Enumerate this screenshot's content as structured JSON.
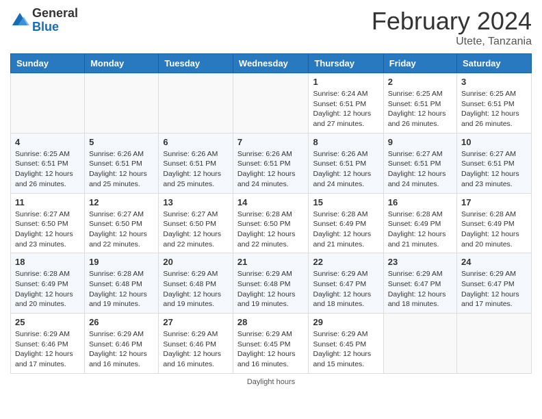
{
  "header": {
    "logo_general": "General",
    "logo_blue": "Blue",
    "month_title": "February 2024",
    "subtitle": "Utete, Tanzania"
  },
  "days_of_week": [
    "Sunday",
    "Monday",
    "Tuesday",
    "Wednesday",
    "Thursday",
    "Friday",
    "Saturday"
  ],
  "weeks": [
    [
      {
        "day": "",
        "info": ""
      },
      {
        "day": "",
        "info": ""
      },
      {
        "day": "",
        "info": ""
      },
      {
        "day": "",
        "info": ""
      },
      {
        "day": "1",
        "info": "Sunrise: 6:24 AM\nSunset: 6:51 PM\nDaylight: 12 hours and 27 minutes."
      },
      {
        "day": "2",
        "info": "Sunrise: 6:25 AM\nSunset: 6:51 PM\nDaylight: 12 hours and 26 minutes."
      },
      {
        "day": "3",
        "info": "Sunrise: 6:25 AM\nSunset: 6:51 PM\nDaylight: 12 hours and 26 minutes."
      }
    ],
    [
      {
        "day": "4",
        "info": "Sunrise: 6:25 AM\nSunset: 6:51 PM\nDaylight: 12 hours and 26 minutes."
      },
      {
        "day": "5",
        "info": "Sunrise: 6:26 AM\nSunset: 6:51 PM\nDaylight: 12 hours and 25 minutes."
      },
      {
        "day": "6",
        "info": "Sunrise: 6:26 AM\nSunset: 6:51 PM\nDaylight: 12 hours and 25 minutes."
      },
      {
        "day": "7",
        "info": "Sunrise: 6:26 AM\nSunset: 6:51 PM\nDaylight: 12 hours and 24 minutes."
      },
      {
        "day": "8",
        "info": "Sunrise: 6:26 AM\nSunset: 6:51 PM\nDaylight: 12 hours and 24 minutes."
      },
      {
        "day": "9",
        "info": "Sunrise: 6:27 AM\nSunset: 6:51 PM\nDaylight: 12 hours and 24 minutes."
      },
      {
        "day": "10",
        "info": "Sunrise: 6:27 AM\nSunset: 6:51 PM\nDaylight: 12 hours and 23 minutes."
      }
    ],
    [
      {
        "day": "11",
        "info": "Sunrise: 6:27 AM\nSunset: 6:50 PM\nDaylight: 12 hours and 23 minutes."
      },
      {
        "day": "12",
        "info": "Sunrise: 6:27 AM\nSunset: 6:50 PM\nDaylight: 12 hours and 22 minutes."
      },
      {
        "day": "13",
        "info": "Sunrise: 6:27 AM\nSunset: 6:50 PM\nDaylight: 12 hours and 22 minutes."
      },
      {
        "day": "14",
        "info": "Sunrise: 6:28 AM\nSunset: 6:50 PM\nDaylight: 12 hours and 22 minutes."
      },
      {
        "day": "15",
        "info": "Sunrise: 6:28 AM\nSunset: 6:49 PM\nDaylight: 12 hours and 21 minutes."
      },
      {
        "day": "16",
        "info": "Sunrise: 6:28 AM\nSunset: 6:49 PM\nDaylight: 12 hours and 21 minutes."
      },
      {
        "day": "17",
        "info": "Sunrise: 6:28 AM\nSunset: 6:49 PM\nDaylight: 12 hours and 20 minutes."
      }
    ],
    [
      {
        "day": "18",
        "info": "Sunrise: 6:28 AM\nSunset: 6:49 PM\nDaylight: 12 hours and 20 minutes."
      },
      {
        "day": "19",
        "info": "Sunrise: 6:28 AM\nSunset: 6:48 PM\nDaylight: 12 hours and 19 minutes."
      },
      {
        "day": "20",
        "info": "Sunrise: 6:29 AM\nSunset: 6:48 PM\nDaylight: 12 hours and 19 minutes."
      },
      {
        "day": "21",
        "info": "Sunrise: 6:29 AM\nSunset: 6:48 PM\nDaylight: 12 hours and 19 minutes."
      },
      {
        "day": "22",
        "info": "Sunrise: 6:29 AM\nSunset: 6:47 PM\nDaylight: 12 hours and 18 minutes."
      },
      {
        "day": "23",
        "info": "Sunrise: 6:29 AM\nSunset: 6:47 PM\nDaylight: 12 hours and 18 minutes."
      },
      {
        "day": "24",
        "info": "Sunrise: 6:29 AM\nSunset: 6:47 PM\nDaylight: 12 hours and 17 minutes."
      }
    ],
    [
      {
        "day": "25",
        "info": "Sunrise: 6:29 AM\nSunset: 6:46 PM\nDaylight: 12 hours and 17 minutes."
      },
      {
        "day": "26",
        "info": "Sunrise: 6:29 AM\nSunset: 6:46 PM\nDaylight: 12 hours and 16 minutes."
      },
      {
        "day": "27",
        "info": "Sunrise: 6:29 AM\nSunset: 6:46 PM\nDaylight: 12 hours and 16 minutes."
      },
      {
        "day": "28",
        "info": "Sunrise: 6:29 AM\nSunset: 6:45 PM\nDaylight: 12 hours and 16 minutes."
      },
      {
        "day": "29",
        "info": "Sunrise: 6:29 AM\nSunset: 6:45 PM\nDaylight: 12 hours and 15 minutes."
      },
      {
        "day": "",
        "info": ""
      },
      {
        "day": "",
        "info": ""
      }
    ]
  ],
  "footer": {
    "note": "Daylight hours"
  }
}
